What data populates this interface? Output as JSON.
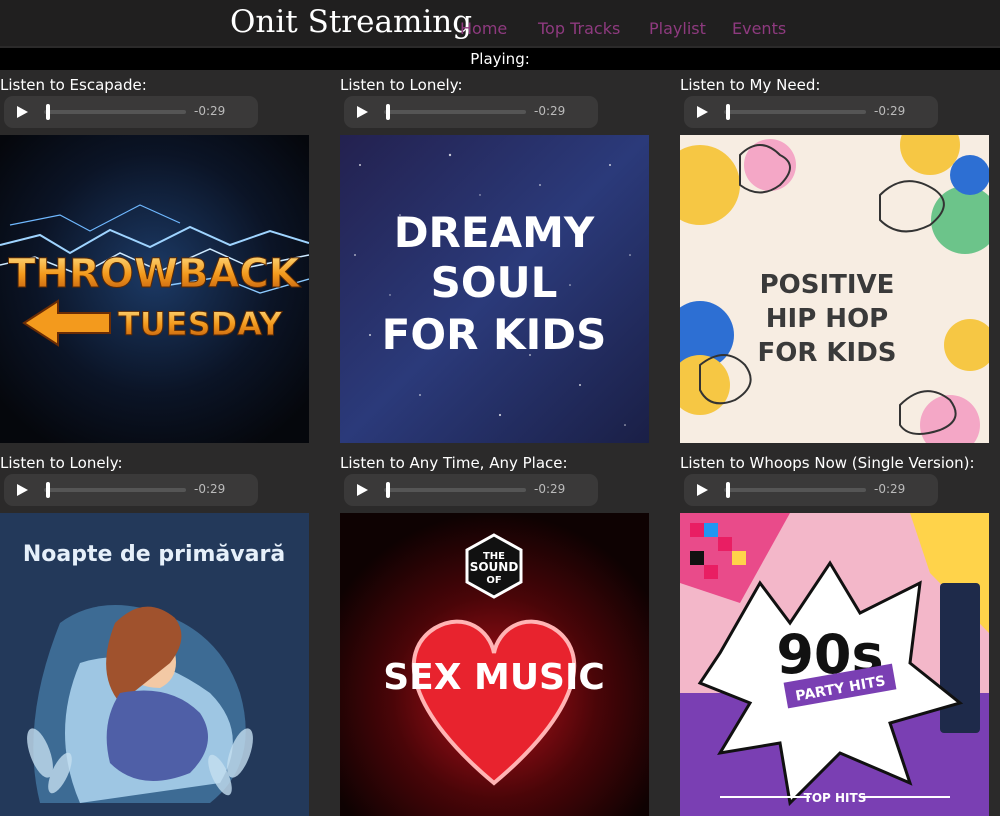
{
  "header": {
    "brand": "Onit Streaming",
    "nav": [
      "Home",
      "Top Tracks",
      "Playlist",
      "Events"
    ]
  },
  "now_playing": "Playing:",
  "tracks": [
    {
      "label": "Listen to Escapade:",
      "time": "-0:29",
      "cover_text": [
        "THROWBACK",
        "TUESDAY"
      ]
    },
    {
      "label": "Listen to Lonely:",
      "time": "-0:29",
      "cover_text": [
        "DREAMY",
        "SOUL",
        "FOR KIDS"
      ]
    },
    {
      "label": "Listen to My Need:",
      "time": "-0:29",
      "cover_text": [
        "POSITIVE",
        "HIP HOP",
        "FOR KIDS"
      ]
    },
    {
      "label": "Listen to Lonely:",
      "time": "-0:29",
      "cover_text": [
        "Noapte de primăvară"
      ]
    },
    {
      "label": "Listen to Any Time, Any Place:",
      "time": "-0:29",
      "cover_text": [
        "THE",
        "SOUND",
        "OF",
        "SEX MUSIC"
      ]
    },
    {
      "label": "Listen to Whoops Now (Single Version):",
      "time": "-0:29",
      "cover_text": [
        "90s",
        "PARTY HITS",
        "TOP HITS"
      ]
    }
  ],
  "colors": {
    "nav_link": "#8e3a7f",
    "header_bg": "#201f1f",
    "page_bg": "#2b2a2a"
  },
  "icons": {
    "play": "play-icon"
  }
}
